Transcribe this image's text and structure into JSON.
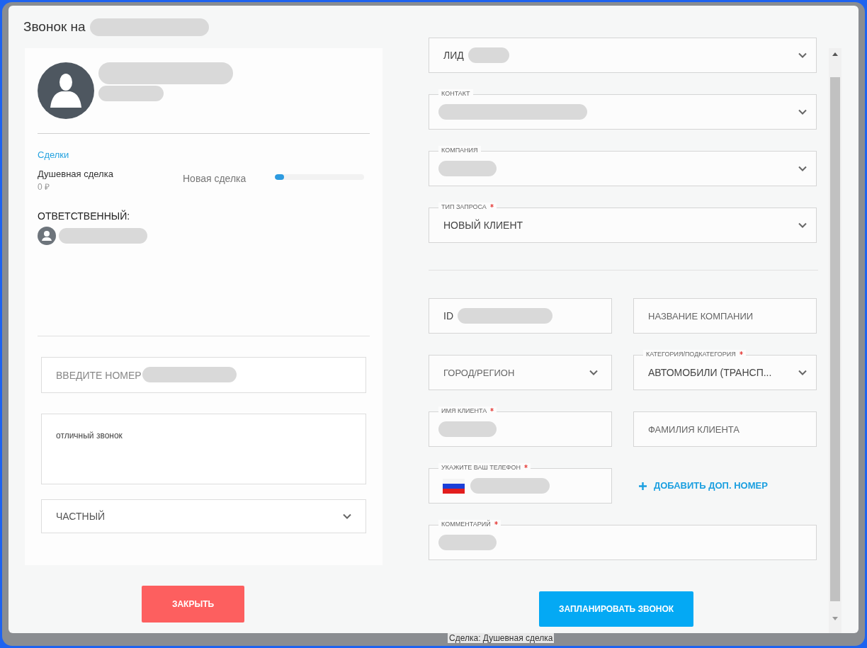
{
  "dialog": {
    "title": "Звонок на",
    "title_redacted": true
  },
  "contact_card": {
    "name_redacted": true,
    "section_link": "Сделки",
    "deal": {
      "name": "Душевная сделка",
      "amount": "0 ₽",
      "stage": "Новая сделка",
      "level": 0.1
    },
    "responsible_label": "ОТВЕТСТВЕННЫЙ:",
    "responsible_redacted": true
  },
  "call_form": {
    "number": {
      "placeholder": "ВВЕДИТЕ НОМЕР",
      "redacted": true
    },
    "note": "отличный звонок",
    "client_type": "ЧАСТНЫЙ"
  },
  "top_fields": [
    {
      "kind": "select",
      "value": "ЛИД",
      "redacted": true,
      "required": false
    },
    {
      "kind": "select",
      "label": "КОНТАКТ",
      "redacted": true,
      "required": false
    },
    {
      "kind": "select",
      "label": "КОМПАНИЯ",
      "redacted": true,
      "required": false
    },
    {
      "kind": "select",
      "label": "ТИП ЗАПРОСА",
      "value": "НОВЫЙ КЛИЕНТ",
      "redacted": false,
      "required": true
    }
  ],
  "grid_fields": [
    {
      "kind": "input",
      "value": "ID",
      "redacted": true,
      "required": false
    },
    {
      "kind": "input",
      "placeholder": "НАЗВАНИЕ КОМПАНИИ",
      "redacted": false,
      "required": false
    },
    {
      "kind": "select",
      "placeholder": "ГОРОД/РЕГИОН",
      "redacted": false,
      "required": false
    },
    {
      "kind": "select",
      "label": "КАТЕГОРИЯ/ПОДКАТЕГОРИЯ",
      "value": "АВТОМОБИЛИ (ТРАНСП...",
      "redacted": false,
      "required": true
    },
    {
      "kind": "input",
      "label": "ИМЯ КЛИЕНТА",
      "redacted": true,
      "required": true
    },
    {
      "kind": "input",
      "placeholder": "ФАМИЛИЯ КЛИЕНТА",
      "redacted": false,
      "required": false
    },
    {
      "kind": "phone",
      "label": "УКАЖИТЕ ВАШ ТЕЛЕФОН",
      "redacted": true,
      "required": true
    },
    {
      "kind": "link",
      "value": "ДОБАВИТЬ ДОП. НОМЕР"
    }
  ],
  "comment_field": {
    "label": "КОММЕНТАРИЙ",
    "redacted": true,
    "required": true
  },
  "buttons": {
    "close": "ЗАКРЫТЬ",
    "schedule": "ЗАПЛАНИРОВАТЬ ЗВОНОК"
  },
  "background_text": "Сделка: Душевная сделка"
}
